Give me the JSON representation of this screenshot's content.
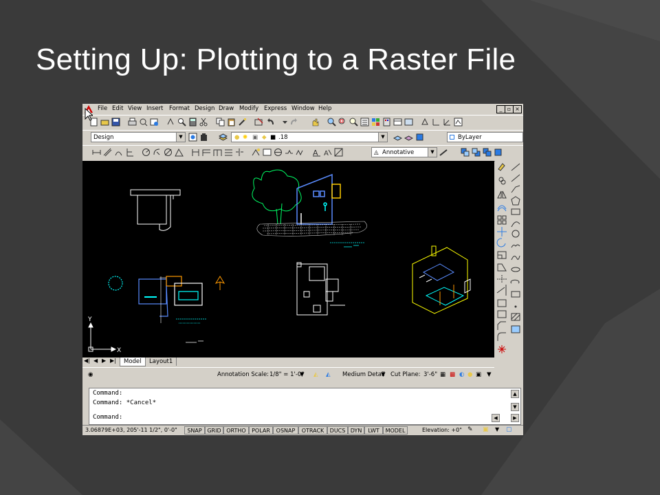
{
  "slide": {
    "title": "Setting Up: Plotting to a Raster File"
  },
  "menu": {
    "items": [
      "File",
      "Edit",
      "View",
      "Insert",
      "Format",
      "Design",
      "Draw",
      "Modify",
      "Express",
      "Window",
      "Help"
    ]
  },
  "toolbar": {
    "workspace": "Design",
    "layer": ".18",
    "color": "ByLayer",
    "annotation_style": "Annotative"
  },
  "canvas": {
    "background": "#000000",
    "labels": {
      "ucs_x": "X",
      "ucs_y": "Y"
    }
  },
  "tabs": {
    "items": [
      "Model",
      "Layout1"
    ],
    "active": "Model"
  },
  "annotation_bar": {
    "scale_label": "Annotation Scale:",
    "scale_value": "1/8\" = 1'-0\"",
    "detail": "Medium Detail",
    "cut_plane_label": "Cut Plane:",
    "cut_plane_value": "3'-6\""
  },
  "command": {
    "lines": [
      "Command:",
      "Command: *Cancel*"
    ],
    "prompt": "Command:"
  },
  "status": {
    "coords": "3.06879E+03, 205'-11 1/2\", 0'-0\"",
    "buttons": [
      "SNAP",
      "GRID",
      "ORTHO",
      "POLAR",
      "OSNAP",
      "OTRACK",
      "DUCS",
      "DYN",
      "LWT",
      "MODEL"
    ],
    "elevation": "Elevation: +0\""
  },
  "colors": {
    "slide_bg": "#3a3a3a",
    "ui_face": "#d4d0c8",
    "cad_white": "#ffffff",
    "cad_cyan": "#00ffff",
    "cad_blue": "#5a8cff",
    "cad_yellow": "#ffff00",
    "cad_green": "#00ff00",
    "cad_orange": "#ff9900"
  }
}
